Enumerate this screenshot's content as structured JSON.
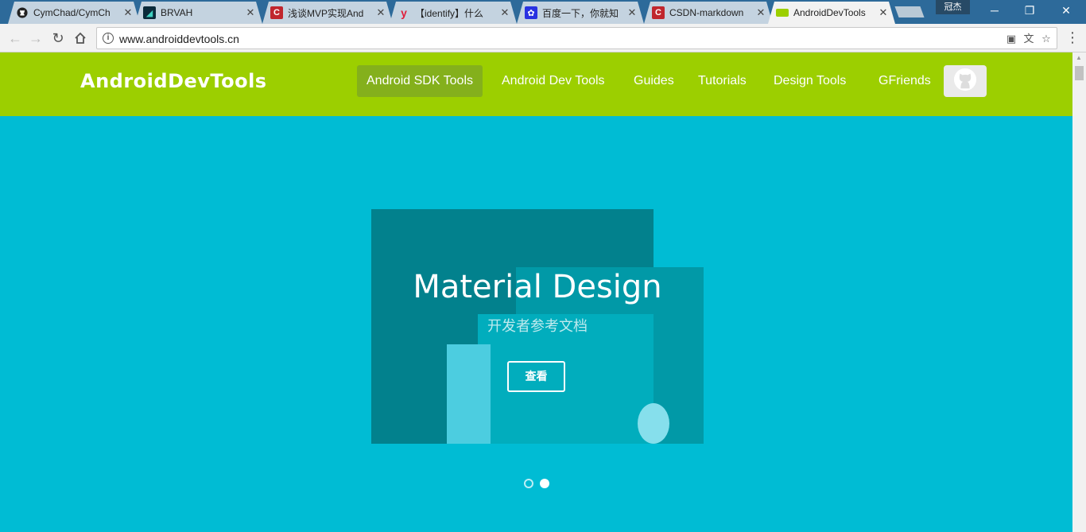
{
  "browser": {
    "tabs": [
      {
        "title": "CymChad/CymCh",
        "favicon": "github-icon",
        "active": false
      },
      {
        "title": "BRVAH",
        "favicon": "brvah-icon",
        "active": false
      },
      {
        "title": "浅谈MVP实现And",
        "favicon": "csdn-icon",
        "active": false
      },
      {
        "title": "【identify】什么",
        "favicon": "youdao-icon",
        "active": false
      },
      {
        "title": "百度一下，你就知",
        "favicon": "baidu-icon",
        "active": false
      },
      {
        "title": "CSDN-markdown",
        "favicon": "csdn-icon",
        "active": false
      },
      {
        "title": "AndroidDevTools",
        "favicon": "androiddevtools-icon",
        "active": true
      }
    ],
    "profile_name": "冠杰",
    "address": {
      "url": "www.androiddevtools.cn"
    },
    "colors": {
      "tabstrip": "#2d6a9a",
      "toolbar": "#f2f2f2"
    }
  },
  "site": {
    "logo_text": "AndroidDevTools",
    "nav": [
      {
        "label": "Android SDK Tools",
        "active": true
      },
      {
        "label": "Android Dev Tools",
        "active": false
      },
      {
        "label": "Guides",
        "active": false
      },
      {
        "label": "Tutorials",
        "active": false
      },
      {
        "label": "Design Tools",
        "active": false
      },
      {
        "label": "GFriends",
        "active": false
      }
    ],
    "colors": {
      "header": "#9ccf00",
      "nav_active": "#84b01c",
      "hero": "#00bcd4"
    }
  },
  "hero": {
    "title": "Material Design",
    "subtitle": "开发者参考文档",
    "button_label": "查看",
    "carousel": {
      "slides": 2,
      "active_index": 1
    }
  }
}
